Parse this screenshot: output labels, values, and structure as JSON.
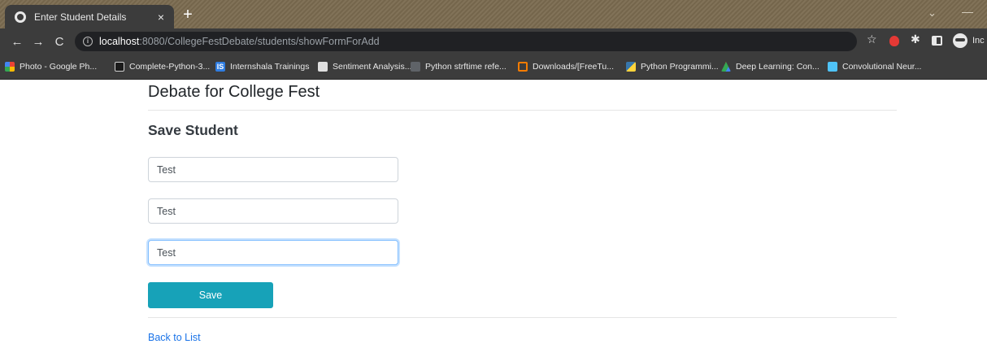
{
  "browser": {
    "tab": {
      "title": "Enter Student Details",
      "close_glyph": "×"
    },
    "new_tab_glyph": "+",
    "window": {
      "chevron_glyph": "⌄",
      "minimize_glyph": "—"
    },
    "toolbar": {
      "back_glyph": "←",
      "forward_glyph": "→",
      "reload_glyph": "C",
      "url_host": "localhost",
      "url_rest": ":8080/CollegeFestDebate/students/showFormForAdd",
      "bookmark_star_glyph": "☆",
      "extensions_glyph": "✱",
      "profile_label": "Inc"
    },
    "bookmarks": [
      {
        "label": "Photo - Google Ph...",
        "icon": "google-photos-icon"
      },
      {
        "label": "Complete-Python-3...",
        "icon": "github-icon"
      },
      {
        "label": "Internshala Trainings",
        "icon": "internshala-icon",
        "icon_text": "IS"
      },
      {
        "label": "Sentiment Analysis...",
        "icon": "document-icon"
      },
      {
        "label": "Python strftime refe...",
        "icon": "globe-icon"
      },
      {
        "label": "Downloads/[FreeTu...",
        "icon": "ring-icon"
      },
      {
        "label": "Python Programmi...",
        "icon": "python-icon"
      },
      {
        "label": "Deep Learning: Con...",
        "icon": "drive-icon"
      },
      {
        "label": "Convolutional Neur...",
        "icon": "shield-icon"
      }
    ]
  },
  "page": {
    "title": "Debate for College Fest",
    "section_title": "Save Student",
    "fields": [
      {
        "value": "Test"
      },
      {
        "value": "Test"
      },
      {
        "value": "Test"
      }
    ],
    "save_label": "Save",
    "back_link": "Back to List"
  },
  "colors": {
    "save_button": "#17a2b8",
    "link": "#1a73e8",
    "focus_border": "#80bdff"
  }
}
